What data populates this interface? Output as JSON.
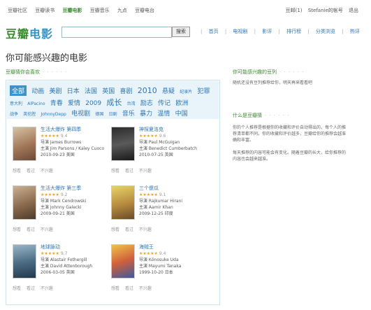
{
  "topnav": {
    "items": [
      "豆瓣社区",
      "豆瓣读书",
      "豆瓣电影",
      "豆瓣音乐",
      "九点",
      "豆瓣电台"
    ],
    "active_index": 2,
    "user": {
      "mail": "豆邮(1)",
      "account": "Stefanie的帐号",
      "logout": "退出"
    }
  },
  "header": {
    "logo_main": "豆瓣",
    "logo_sub": "电影",
    "search_placeholder": "",
    "search_button": "搜索",
    "nav": [
      "首页",
      "电视剧",
      "影评",
      "排行榜",
      "分类浏览",
      "热评"
    ]
  },
  "page_title": "你可能感兴趣的电影",
  "section_label": "豆瓣猜你会喜欢",
  "tags": [
    [
      {
        "t": "全部",
        "s": "md",
        "active": true
      },
      {
        "t": "动画",
        "s": "md"
      },
      {
        "t": "美剧",
        "s": "md"
      },
      {
        "t": "日本",
        "s": "md"
      },
      {
        "t": "法国",
        "s": "md"
      },
      {
        "t": "英国",
        "s": "md"
      },
      {
        "t": "喜剧",
        "s": "md"
      },
      {
        "t": "2010",
        "s": "lg"
      },
      {
        "t": "悬疑",
        "s": "md"
      },
      {
        "t": "纪录片",
        "s": "sm"
      },
      {
        "t": "犯罪",
        "s": "md"
      }
    ],
    [
      {
        "t": "意大利",
        "s": "sm"
      },
      {
        "t": "AlPacino",
        "s": "sm"
      },
      {
        "t": "青春",
        "s": "md"
      },
      {
        "t": "爱情",
        "s": "md"
      },
      {
        "t": "2009",
        "s": "md"
      },
      {
        "t": "成长",
        "s": "lg"
      },
      {
        "t": "台湾",
        "s": "sm"
      },
      {
        "t": "励志",
        "s": "md"
      },
      {
        "t": "传记",
        "s": "md"
      },
      {
        "t": "欧洲",
        "s": "md"
      }
    ],
    [
      {
        "t": "战争",
        "s": "sm"
      },
      {
        "t": "英伦腔",
        "s": "sm"
      },
      {
        "t": "JohnnyDepp",
        "s": "sm"
      },
      {
        "t": "电视剧",
        "s": "md"
      },
      {
        "t": "德国",
        "s": "sm"
      },
      {
        "t": "日剧",
        "s": "sm"
      },
      {
        "t": "音乐",
        "s": "md"
      },
      {
        "t": "暴力",
        "s": "md"
      },
      {
        "t": "温情",
        "s": "md"
      },
      {
        "t": "中国",
        "s": "md"
      }
    ]
  ],
  "movies": [
    {
      "title": "生活大爆炸 第四季",
      "rating": "★★★★★",
      "score": "9.4",
      "director": "导演 James Burrows",
      "cast": "主演 Jim Parsons / Kaley Cuoco",
      "date": "2010-09-23 美国",
      "actions": [
        "想看",
        "看过",
        "不兴趣"
      ]
    },
    {
      "title": "神探夏洛克",
      "rating": "★★★★★",
      "score": "9.6",
      "director": "导演 Paul McGuigan",
      "cast": "主演 Benedict Cumberbatch",
      "date": "2010-07-25 英国",
      "actions": [
        "想看",
        "看过",
        "不兴趣"
      ]
    },
    {
      "title": "生活大爆炸 第三季",
      "rating": "★★★★★",
      "score": "9.2",
      "director": "导演 Mark Cendrowski",
      "cast": "主演 Johnny Galecki",
      "date": "2009-09-21 美国",
      "actions": [
        "想看",
        "看过",
        "不兴趣"
      ]
    },
    {
      "title": "三个傻瓜",
      "rating": "★★★★★",
      "score": "9.1",
      "director": "导演 Rajkumar Hirani",
      "cast": "主演 Aamir Khan",
      "date": "2009-12-25 印度",
      "actions": [
        "想看",
        "看过",
        "不兴趣"
      ]
    },
    {
      "title": "地球脉动",
      "rating": "★★★★★",
      "score": "9.7",
      "director": "导演 Alastair Fothergill",
      "cast": "主演 David Attenborough",
      "date": "2006-03-05 英国",
      "actions": [
        "想看",
        "看过",
        "不兴趣"
      ]
    },
    {
      "title": "海贼王",
      "rating": "★★★★★",
      "score": "9.4",
      "director": "导演 Kōnosuke Uda",
      "cast": "主演 Mayumi Tanaka",
      "date": "1999-10-20 日本",
      "actions": [
        "想看",
        "看过",
        "不兴趣"
      ]
    }
  ],
  "right": {
    "label1": "你可能感兴趣的豆列",
    "text1": "随机还没有豆列推荐给你，明天再来看看吧",
    "label2": "什么是豆瓣猜",
    "text2": "你的个人推荐是根据你的收藏和评价自动得出的，每个人的推荐清单都不同。你的收藏和评价越多，豆瓣给你的推荐会越准确和丰富。",
    "text3": "每天推荐的内容可能会有变化。随着豆瓣的长大，给你推荐的内容也会越来越准。"
  },
  "colors": {
    "green": "#3a8b2f",
    "blue": "#2f76b6",
    "tagbg": "#e9f4fa",
    "border": "#cfe3ee"
  }
}
